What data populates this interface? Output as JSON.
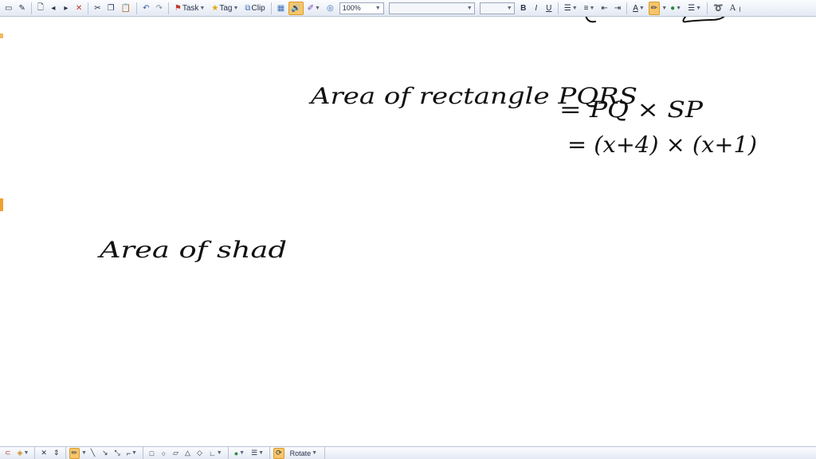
{
  "toolbar": {
    "task_label": "Task",
    "tag_label": "Tag",
    "clip_label": "Clip",
    "zoom_value": "100%",
    "font_name": "",
    "font_size": "",
    "bold": "B",
    "italic": "I",
    "underline": "U",
    "font_color_glyph": "A",
    "text_tool_glyph": "A",
    "accent_color": "#f7c56a",
    "icons": [
      "screen-clip-icon",
      "pen-icon",
      "new-page-icon",
      "prev-page-icon",
      "next-page-icon",
      "delete-page-icon",
      "cut-icon",
      "copy-icon",
      "paste-icon",
      "undo-icon",
      "redo-icon",
      "flag-icon",
      "star-icon",
      "clip-icon",
      "table-icon",
      "sound-icon",
      "pen-color-icon",
      "at-icon",
      "bullets-icon",
      "numbering-icon",
      "decrease-indent-icon",
      "increase-indent-icon",
      "highlighter-icon",
      "fill-color-icon",
      "line-style-icon",
      "lasso-icon"
    ]
  },
  "bottombar": {
    "rotate_label": "Rotate",
    "icons": [
      "lasso-select-icon",
      "eraser-icon",
      "delete-icon",
      "spacing-icon",
      "pen-tool-icon",
      "line-icon",
      "arrow-icon",
      "connector-icon",
      "rectangle-icon",
      "ellipse-icon",
      "parallelogram-icon",
      "triangle-icon",
      "diamond-icon",
      "axis-icon",
      "color-icon",
      "line-weight-icon",
      "rotate-icon"
    ]
  },
  "notes": {
    "line1": "Area of rectangle PQRS",
    "line2": "= PQ × SP",
    "line3": "= (x+4) × (x+1)",
    "line4": "Area of shad"
  }
}
